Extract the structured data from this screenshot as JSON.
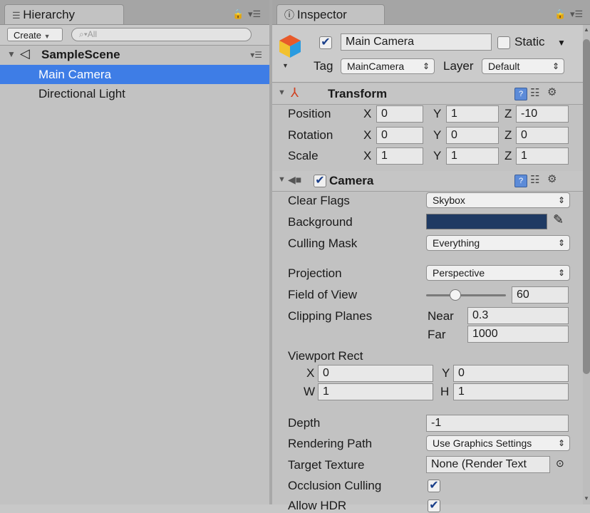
{
  "hierarchy": {
    "tab_label": "Hierarchy",
    "create_label": "Create",
    "search_placeholder": "All",
    "scene_name": "SampleScene",
    "items": [
      {
        "label": "Main Camera",
        "selected": true
      },
      {
        "label": "Directional Light",
        "selected": false
      }
    ]
  },
  "inspector": {
    "tab_label": "Inspector",
    "object": {
      "active": true,
      "name": "Main Camera",
      "static_label": "Static",
      "static_checked": false,
      "tag_label": "Tag",
      "tag_value": "MainCamera",
      "layer_label": "Layer",
      "layer_value": "Default"
    },
    "transform": {
      "title": "Transform",
      "rows": [
        {
          "label": "Position",
          "x": "0",
          "y": "1",
          "z": "-10"
        },
        {
          "label": "Rotation",
          "x": "0",
          "y": "0",
          "z": "0"
        },
        {
          "label": "Scale",
          "x": "1",
          "y": "1",
          "z": "1"
        }
      ],
      "axis_x": "X",
      "axis_y": "Y",
      "axis_z": "Z"
    },
    "camera": {
      "title": "Camera",
      "enabled": true,
      "clear_flags_label": "Clear Flags",
      "clear_flags_value": "Skybox",
      "background_label": "Background",
      "background_color": "#1f3a63",
      "culling_mask_label": "Culling Mask",
      "culling_mask_value": "Everything",
      "projection_label": "Projection",
      "projection_value": "Perspective",
      "fov_label": "Field of View",
      "fov_value": "60",
      "fov_fraction": 0.36,
      "clipping_label": "Clipping Planes",
      "near_label": "Near",
      "near_value": "0.3",
      "far_label": "Far",
      "far_value": "1000",
      "viewport_label": "Viewport Rect",
      "vp_x_label": "X",
      "vp_x": "0",
      "vp_y_label": "Y",
      "vp_y": "0",
      "vp_w_label": "W",
      "vp_w": "1",
      "vp_h_label": "H",
      "vp_h": "1",
      "depth_label": "Depth",
      "depth_value": "-1",
      "rendering_path_label": "Rendering Path",
      "rendering_path_value": "Use Graphics Settings",
      "target_texture_label": "Target Texture",
      "target_texture_value": "None (Render Text",
      "occlusion_label": "Occlusion Culling",
      "occlusion_checked": true,
      "allow_hdr_label": "Allow HDR",
      "allow_hdr_checked": true
    }
  },
  "colors": {
    "selection": "#3e7de6",
    "panel": "#c2c2c2"
  }
}
